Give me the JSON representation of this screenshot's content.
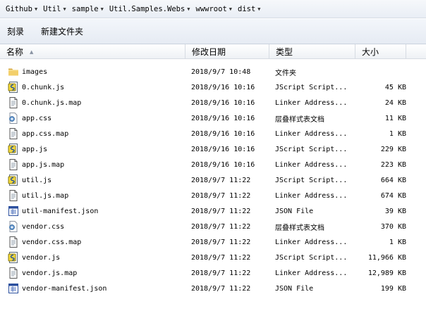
{
  "breadcrumb": [
    "Github",
    "Util",
    "sample",
    "Util.Samples.Webs",
    "wwwroot",
    "dist"
  ],
  "toolbar": {
    "burn_label": "刻录",
    "new_folder_label": "新建文件夹"
  },
  "columns": {
    "name": "名称",
    "date": "修改日期",
    "type": "类型",
    "size": "大小"
  },
  "files": [
    {
      "name": "images",
      "date": "2018/9/7 10:48",
      "type": "文件夹",
      "size": "",
      "icon": "folder-icon"
    },
    {
      "name": "0.chunk.js",
      "date": "2018/9/16 10:16",
      "type": "JScript Script...",
      "size": "45 KB",
      "icon": "jscript-file-icon"
    },
    {
      "name": "0.chunk.js.map",
      "date": "2018/9/16 10:16",
      "type": "Linker Address...",
      "size": "24 KB",
      "icon": "map-file-icon"
    },
    {
      "name": "app.css",
      "date": "2018/9/16 10:16",
      "type": "层叠样式表文档",
      "size": "11 KB",
      "icon": "css-file-icon"
    },
    {
      "name": "app.css.map",
      "date": "2018/9/16 10:16",
      "type": "Linker Address...",
      "size": "1 KB",
      "icon": "map-file-icon"
    },
    {
      "name": "app.js",
      "date": "2018/9/16 10:16",
      "type": "JScript Script...",
      "size": "229 KB",
      "icon": "jscript-file-icon"
    },
    {
      "name": "app.js.map",
      "date": "2018/9/16 10:16",
      "type": "Linker Address...",
      "size": "223 KB",
      "icon": "map-file-icon"
    },
    {
      "name": "util.js",
      "date": "2018/9/7 11:22",
      "type": "JScript Script...",
      "size": "664 KB",
      "icon": "jscript-file-icon"
    },
    {
      "name": "util.js.map",
      "date": "2018/9/7 11:22",
      "type": "Linker Address...",
      "size": "674 KB",
      "icon": "map-file-icon"
    },
    {
      "name": "util-manifest.json",
      "date": "2018/9/7 11:22",
      "type": "JSON File",
      "size": "39 KB",
      "icon": "json-file-icon"
    },
    {
      "name": "vendor.css",
      "date": "2018/9/7 11:22",
      "type": "层叠样式表文档",
      "size": "370 KB",
      "icon": "css-file-icon"
    },
    {
      "name": "vendor.css.map",
      "date": "2018/9/7 11:22",
      "type": "Linker Address...",
      "size": "1 KB",
      "icon": "map-file-icon"
    },
    {
      "name": "vendor.js",
      "date": "2018/9/7 11:22",
      "type": "JScript Script...",
      "size": "11,966 KB",
      "icon": "jscript-file-icon"
    },
    {
      "name": "vendor.js.map",
      "date": "2018/9/7 11:22",
      "type": "Linker Address...",
      "size": "12,989 KB",
      "icon": "map-file-icon"
    },
    {
      "name": "vendor-manifest.json",
      "date": "2018/9/7 11:22",
      "type": "JSON File",
      "size": "199 KB",
      "icon": "json-file-icon"
    }
  ]
}
